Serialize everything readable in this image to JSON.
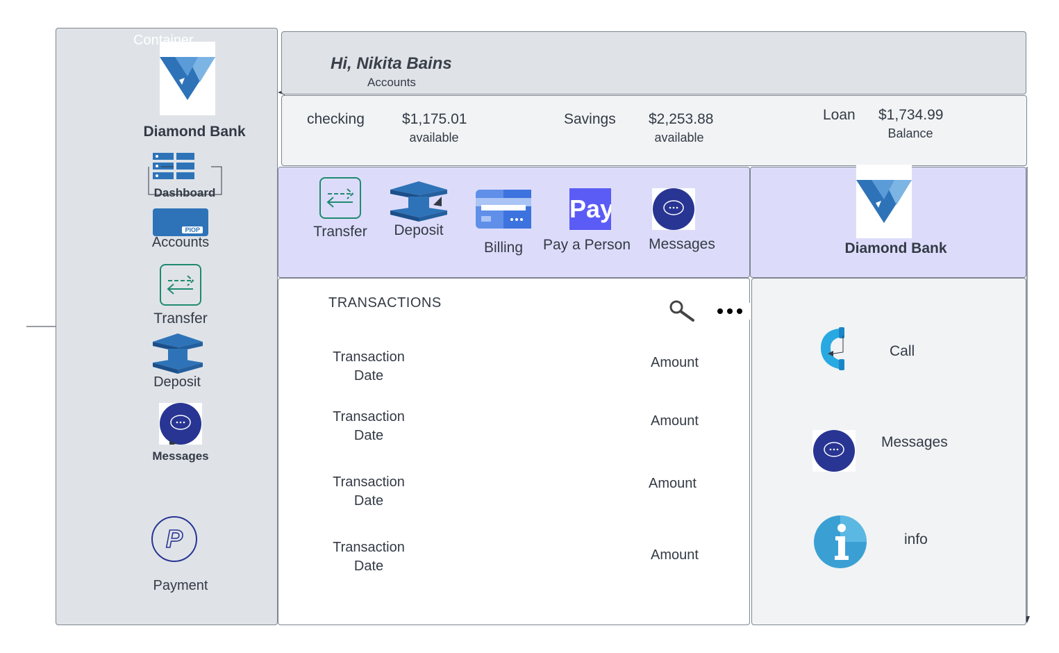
{
  "sidebar": {
    "container_label": "Container",
    "bank_name": "Diamond Bank",
    "items": [
      {
        "label": "Dashboard",
        "icon": "dashboard-icon"
      },
      {
        "label": "Accounts",
        "icon": "card-icon",
        "card_text": "PIOP"
      },
      {
        "label": "Transfer",
        "icon": "transfer-icon"
      },
      {
        "label": "Deposit",
        "icon": "deposit-icon"
      },
      {
        "label": "Messages",
        "icon": "chat-icon"
      },
      {
        "label": "Payment",
        "icon": "paypal-icon"
      }
    ]
  },
  "header": {
    "greeting": "Hi, Nikita Bains",
    "subtitle": "Accounts"
  },
  "accounts": [
    {
      "name": "checking",
      "amount": "$1,175.01",
      "note": "available"
    },
    {
      "name": "Savings",
      "amount": "$2,253.88",
      "note": "available"
    },
    {
      "name": "Loan",
      "amount": "$1,734.99",
      "note": "Balance"
    }
  ],
  "actions": [
    {
      "label": "Transfer",
      "icon": "transfer-icon"
    },
    {
      "label": "Deposit",
      "icon": "deposit-icon"
    },
    {
      "label": "Billing",
      "icon": "billing-card-icon"
    },
    {
      "label": "Pay a Person",
      "icon": "pay-icon",
      "icon_text": "Pay"
    },
    {
      "label": "Messages",
      "icon": "chat-icon"
    }
  ],
  "brand_panel": {
    "bank_name": "Diamond Bank"
  },
  "transactions": {
    "title": "TRANSACTIONS",
    "rows": [
      {
        "date": "Transaction\nDate",
        "amount": "Amount"
      },
      {
        "date": "Transaction\nDate",
        "amount": "Amount"
      },
      {
        "date": "Transaction\nDate",
        "amount": "Amount"
      },
      {
        "date": "Transaction\nDate",
        "amount": "Amount"
      }
    ]
  },
  "contact": [
    {
      "label": "Call",
      "icon": "phone-icon"
    },
    {
      "label": "Messages",
      "icon": "chat-icon"
    },
    {
      "label": "info",
      "icon": "info-icon"
    }
  ],
  "colors": {
    "panel_gray": "#dfe3e8",
    "panel_light": "#f1f3f5",
    "panel_lavender": "#dcdcfa",
    "brand_blue": "#2e73b8",
    "chat_navy": "#283593",
    "transfer_green": "#1f8a70",
    "pay_purple": "#5b5bf6",
    "info_blue": "#3aa0d4"
  }
}
